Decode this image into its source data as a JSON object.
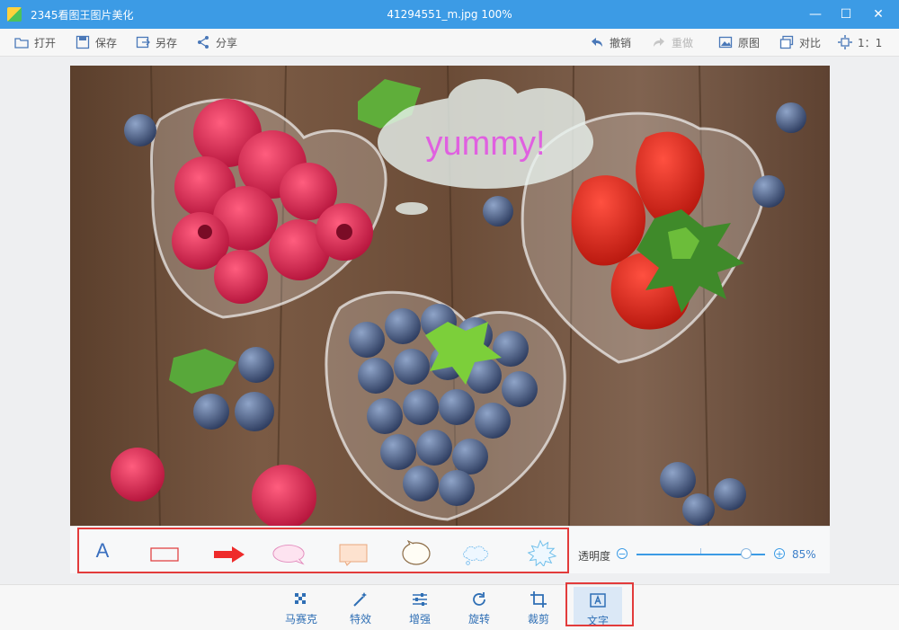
{
  "titlebar": {
    "app_name": "2345看图王图片美化",
    "file_title": "41294551_m.jpg  100%",
    "minimize": "—",
    "maximize": "☐",
    "close": "✕"
  },
  "toolbar": {
    "open": "打开",
    "save": "保存",
    "save_as": "另存",
    "share": "分享",
    "undo": "撤销",
    "redo": "重做",
    "original": "原图",
    "compare": "对比",
    "ratio": "1：1"
  },
  "photo": {
    "caption_text": "yummy!",
    "caption_color": "#e060e0"
  },
  "text_panel": {
    "font_glyph": "A",
    "opacity_label": "透明度",
    "opacity_value": "85%",
    "opacity_fraction": 0.85
  },
  "bottom_tools": {
    "mosaic": "马赛克",
    "effects": "特效",
    "enhance": "增强",
    "rotate": "旋转",
    "crop": "裁剪",
    "text": "文字"
  },
  "colors": {
    "accent": "#3c9be5",
    "highlight_border": "#e23b3b"
  }
}
